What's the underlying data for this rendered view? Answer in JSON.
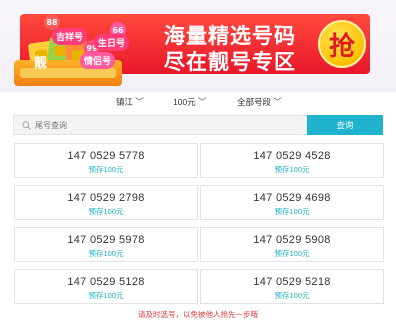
{
  "banner": {
    "line1": "海量精选号码",
    "line2": "尽在靓号专区",
    "grab_label": "抢",
    "tags": {
      "auspicious": "吉祥号",
      "birthday": "生日号",
      "lovers": "情侣号",
      "mark": "靓",
      "badge_88": "88",
      "badge_66": "66",
      "badge_99": "99"
    }
  },
  "filters": {
    "city": "镇江",
    "price": "100元",
    "segment": "全部号段"
  },
  "search": {
    "placeholder": "尾号查询",
    "button_label": "查询"
  },
  "numbers": [
    {
      "number": "147 0529 5778",
      "deposit": "预存100元"
    },
    {
      "number": "147 0529 4528",
      "deposit": "预存100元"
    },
    {
      "number": "147 0529 2798",
      "deposit": "预存100元"
    },
    {
      "number": "147 0529 4698",
      "deposit": "预存100元"
    },
    {
      "number": "147 0529 5978",
      "deposit": "预存100元"
    },
    {
      "number": "147 0529 5908",
      "deposit": "预存100元"
    },
    {
      "number": "147 0529 5128",
      "deposit": "预存100元"
    },
    {
      "number": "147 0529 5218",
      "deposit": "预存100元"
    }
  ],
  "footer": {
    "note": "请及时选号，以免被他人抢先一步哦"
  },
  "colors": {
    "accent": "#1fb3ce",
    "banner_red": "#e9162a",
    "grab_gold": "#ffc000",
    "deposit_text": "#1ab0c9",
    "footer_text": "#e43a3a"
  }
}
